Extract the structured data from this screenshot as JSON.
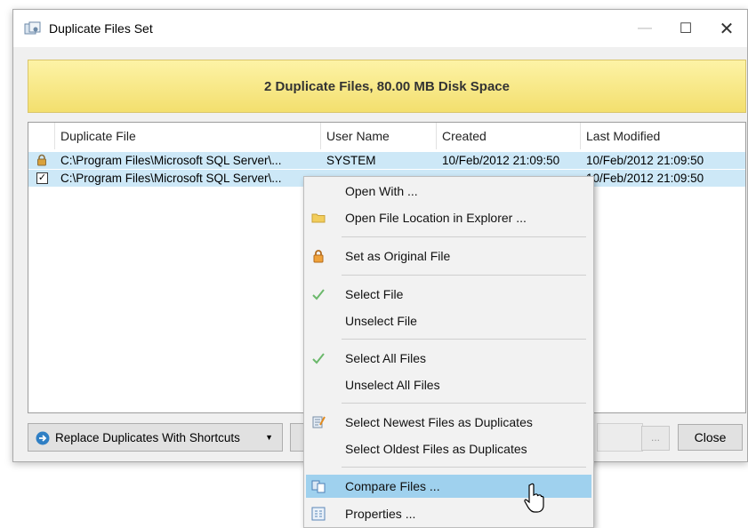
{
  "window": {
    "title": "Duplicate Files Set",
    "controls": {
      "minimize": "—",
      "maximize": "☐",
      "close": "✕"
    }
  },
  "banner": {
    "text": "2 Duplicate Files, 80.00 MB Disk Space"
  },
  "table": {
    "columns": [
      "Duplicate File",
      "User Name",
      "Created",
      "Last Modified"
    ],
    "rows": [
      {
        "icon": "lock-icon",
        "file": "C:\\Program Files\\Microsoft SQL Server\\...",
        "user": "SYSTEM",
        "created": "10/Feb/2012 21:09:50",
        "modified": "10/Feb/2012 21:09:50",
        "selected": true
      },
      {
        "icon": "checkbox",
        "checked": true,
        "check_glyph": "✓",
        "file": "C:\\Program Files\\Microsoft SQL Server\\...",
        "modified": "10/Feb/2012 21:09:50",
        "selected": true
      }
    ]
  },
  "bottom": {
    "replace_button": "Replace Duplicates With Shortcuts",
    "ellipsis_button": "...",
    "close_button": "Close"
  },
  "context_menu": {
    "items": [
      {
        "label": "Open With ...",
        "icon": ""
      },
      {
        "label": "Open File Location in Explorer ...",
        "icon": "folder-icon"
      },
      {
        "label": "Set as Original File",
        "icon": "lock-icon"
      },
      {
        "label": "Select File",
        "icon": "checkmark-icon"
      },
      {
        "label": "Unselect File",
        "icon": ""
      },
      {
        "label": "Select All Files",
        "icon": "checkmark-icon"
      },
      {
        "label": "Unselect All Files",
        "icon": ""
      },
      {
        "label": "Select Newest Files as Duplicates",
        "icon": "edit-list-icon"
      },
      {
        "label": "Select Oldest Files as Duplicates",
        "icon": ""
      },
      {
        "label": "Compare Files ...",
        "icon": "compare-icon",
        "highlighted": true
      },
      {
        "label": "Properties ...",
        "icon": "properties-icon"
      }
    ]
  },
  "colors": {
    "banner_top": "#fdf3a6",
    "banner_bottom": "#f3df6e",
    "row_selected": "#cde8f7",
    "menu_highlight": "#9fd1ee",
    "check_green": "#6bb86b"
  }
}
